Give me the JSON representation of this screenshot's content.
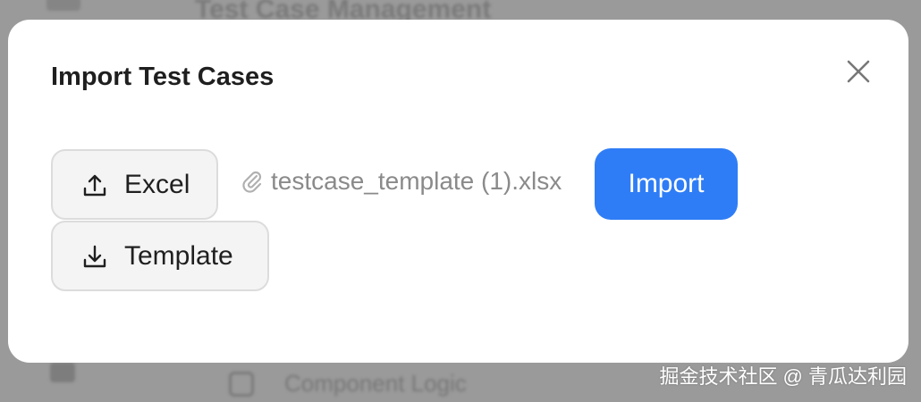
{
  "background": {
    "title": "Test Case Management",
    "bottom_item": "Component Logic"
  },
  "watermark": "掘金技术社区 @ 青瓜达利园",
  "modal": {
    "title": "Import Test Cases",
    "close_icon": "close-icon",
    "excel_button": {
      "label": "Excel",
      "icon": "upload-icon"
    },
    "template_button": {
      "label": "Template",
      "icon": "download-icon"
    },
    "selected_file": {
      "name": "testcase_template (1).xlsx",
      "icon": "paperclip-icon"
    },
    "import_button": {
      "label": "Import"
    }
  },
  "colors": {
    "primary": "#2f7df6",
    "overlay": "#9a9a9a",
    "button_bg": "#f4f4f4",
    "muted_text": "#8a8a8a"
  }
}
